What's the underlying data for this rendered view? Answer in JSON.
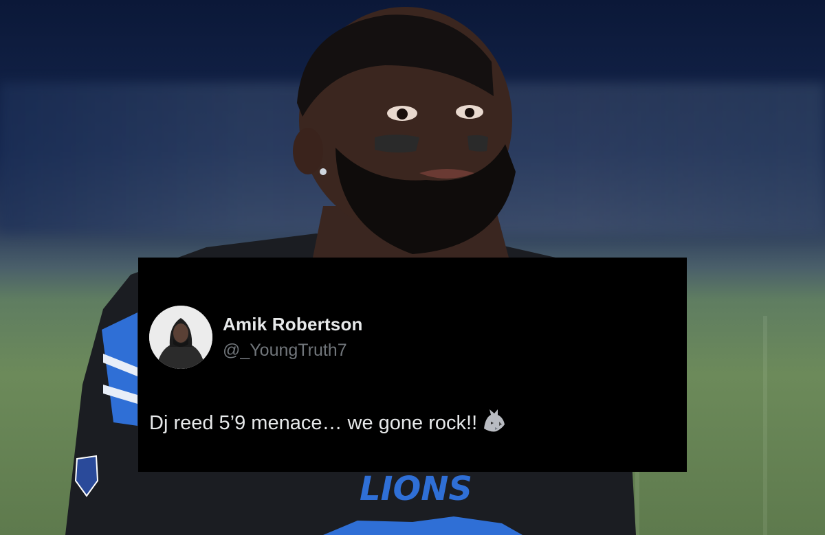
{
  "tweet": {
    "display_name": "Amik Robertson",
    "handle": "@_YoungTruth7",
    "text": "Dj reed 5’9 menace… we gone rock!!",
    "emoji": "wolf-icon"
  },
  "background": {
    "jersey_text": "LIONS",
    "colors": {
      "stadium": "#0b1838",
      "field": "#6c8a5a",
      "jersey": "#1b1d22",
      "lions_blue": "#2f6fd6"
    }
  }
}
